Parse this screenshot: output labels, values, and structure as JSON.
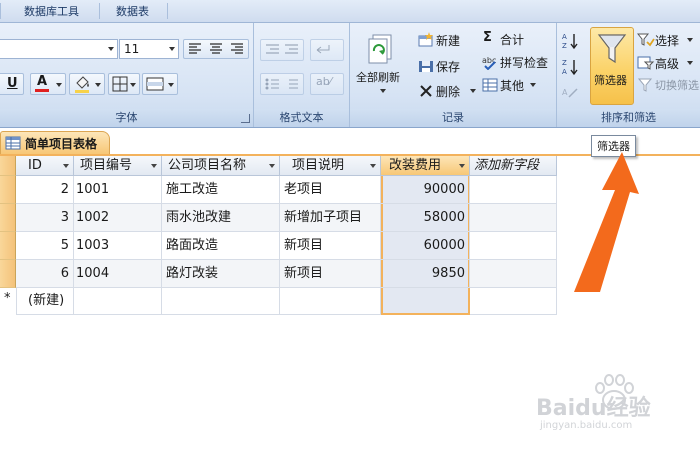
{
  "ribbon_tabs": [
    "数据库工具",
    "数据表"
  ],
  "groups": {
    "font": {
      "label": "字体",
      "font_size": "11",
      "underline": "U",
      "font_color": "A"
    },
    "rich_text": {
      "label": "格式文本"
    },
    "records": {
      "label": "记录",
      "refresh_all": "全部刷新",
      "new": "新建",
      "save": "保存",
      "delete": "删除",
      "totals": "合计",
      "spelling": "拼写检查",
      "more": "其他"
    },
    "sort_filter": {
      "label": "排序和筛选",
      "filter": "筛选器",
      "selection": "选择",
      "advanced": "高级",
      "toggle_filter": "切换筛选"
    }
  },
  "tooltip": "筛选器",
  "document_tab": "简单项目表格",
  "table": {
    "columns": [
      "ID",
      "项目编号",
      "公司项目名称",
      "项目说明",
      "改装费用",
      "添加新字段"
    ],
    "rows": [
      {
        "id": "2",
        "code": "1001",
        "name": "施工改造",
        "desc": "老项目",
        "cost": "90000"
      },
      {
        "id": "3",
        "code": "1002",
        "name": "雨水池改建",
        "desc": "新增加子项目",
        "cost": "58000"
      },
      {
        "id": "5",
        "code": "1003",
        "name": "路面改造",
        "desc": "新项目",
        "cost": "60000"
      },
      {
        "id": "6",
        "code": "1004",
        "name": "路灯改装",
        "desc": "新项目",
        "cost": "9850"
      }
    ],
    "new_row_marker": "*",
    "new_row_label": "(新建)"
  },
  "watermark": {
    "brand": "Baidu经验",
    "url": "jingyan.baidu.com"
  },
  "colors": {
    "ribbon": "#d6e3f4",
    "selected_column": "#e2e8f3",
    "accent_orange": "#f36a1c",
    "highlight": "#fbd36a"
  }
}
